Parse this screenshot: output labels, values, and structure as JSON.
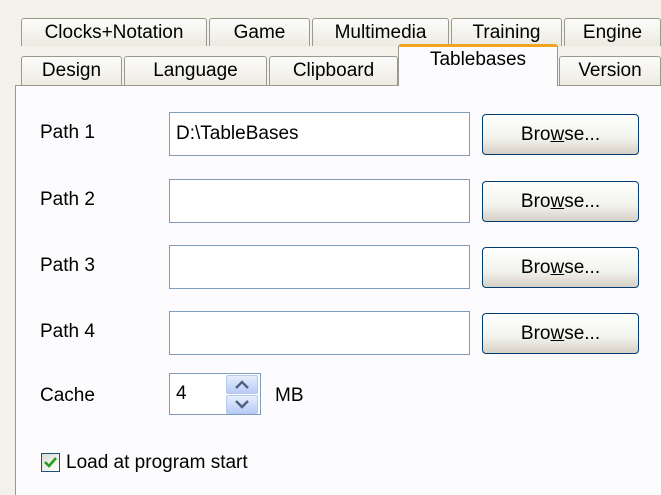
{
  "tabs_row1": [
    "Clocks+Notation",
    "Game",
    "Multimedia",
    "Training",
    "Engine"
  ],
  "tabs_row2": [
    "Design",
    "Language",
    "Clipboard",
    "Tablebases",
    "Version"
  ],
  "active_tab": "Tablebases",
  "paths": [
    {
      "label": "Path 1",
      "value": "D:\\TableBases"
    },
    {
      "label": "Path 2",
      "value": ""
    },
    {
      "label": "Path 3",
      "value": ""
    },
    {
      "label": "Path 4",
      "value": ""
    }
  ],
  "browse": {
    "pre": "Bro",
    "mnemonic": "w",
    "post": "se..."
  },
  "cache": {
    "label": "Cache",
    "value": "4",
    "unit": "MB",
    "up_icon": "arrow-up-icon",
    "down_icon": "arrow-down-icon"
  },
  "load_at_start": {
    "label": "Load at program start",
    "checked": true,
    "icon": "checkmark-icon"
  },
  "colors": {
    "active_tab_accent": "#f1a51e",
    "field_border": "#7f9db9",
    "button_border": "#003c74",
    "check_green": "#21a121"
  }
}
